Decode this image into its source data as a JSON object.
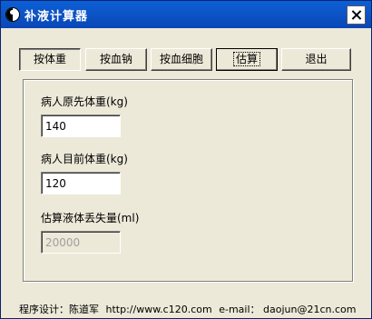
{
  "window": {
    "title": "补液计算器"
  },
  "tabs": [
    {
      "label": "按体重"
    },
    {
      "label": "按血钠"
    },
    {
      "label": "按血细胞"
    },
    {
      "label": "估算"
    },
    {
      "label": "退出"
    }
  ],
  "form": {
    "original_weight_label": "病人原先体重(kg)",
    "original_weight_value": "140",
    "current_weight_label": "病人目前体重(kg)",
    "current_weight_value": "120",
    "fluid_loss_label": "估算液体丢失量(ml)",
    "fluid_loss_value": "20000"
  },
  "footer": {
    "designer": "程序设计：陈道军",
    "url": "http://www.c120.com",
    "email": "e-mail： daojun@21cn.com"
  }
}
